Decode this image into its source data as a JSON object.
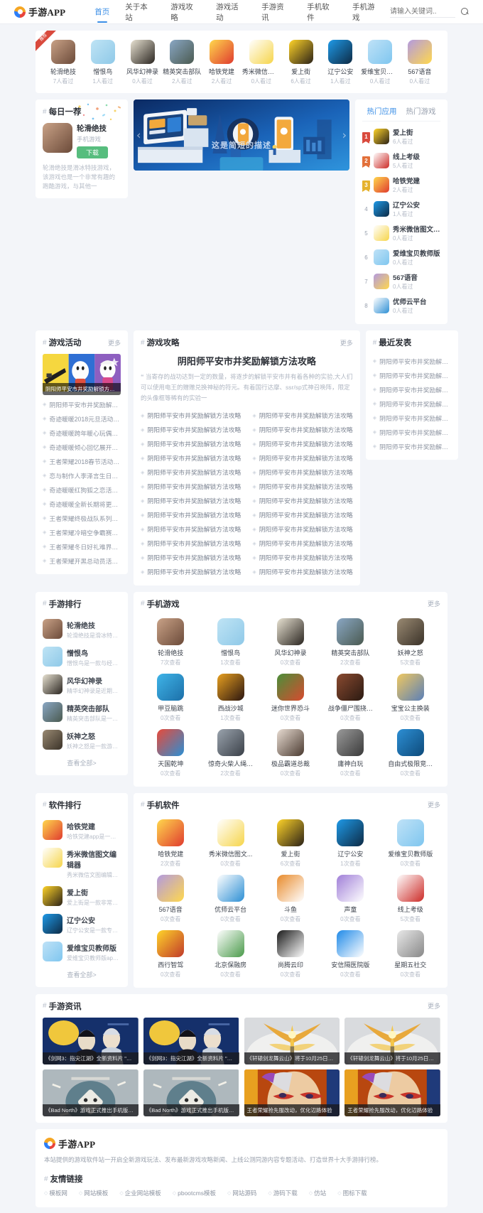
{
  "header": {
    "logo_text": "手游APP",
    "nav": [
      {
        "label": "首页",
        "active": true
      },
      {
        "label": "关于本站",
        "active": false
      },
      {
        "label": "游戏攻略",
        "active": false
      },
      {
        "label": "游戏活动",
        "active": false
      },
      {
        "label": "手游资讯",
        "active": false
      },
      {
        "label": "手机软件",
        "active": false
      },
      {
        "label": "手机游戏",
        "active": false
      }
    ],
    "search_placeholder": "请输入关键词..",
    "search_value": ""
  },
  "apps_row": {
    "ribbon_label": "推荐",
    "items": [
      {
        "name": "轮滑绝技",
        "count": "7人看过",
        "c1": "#c9a287",
        "c2": "#6b4a39"
      },
      {
        "name": "憎恨鸟",
        "count": "1人看过",
        "c1": "#bfe4f5",
        "c2": "#8fc9e8"
      },
      {
        "name": "风华幻神录",
        "count": "0人看过",
        "c1": "#e8e2d2",
        "c2": "#2a2520"
      },
      {
        "name": "精英突击部队",
        "count": "2人看过",
        "c1": "#8aa7c4",
        "c2": "#4a5a50"
      },
      {
        "name": "哈铁党建",
        "count": "2人看过",
        "c1": "#ffd84d",
        "c2": "#e03b2f"
      },
      {
        "name": "秀米微信图文编...",
        "count": "0人看过",
        "c1": "#ffffff",
        "c2": "#f6d54a"
      },
      {
        "name": "爱上街",
        "count": "6人看过",
        "c1": "#ffd429",
        "c2": "#2a2117"
      },
      {
        "name": "辽宁公安",
        "count": "1人看过",
        "c1": "#1f9ae8",
        "c2": "#0d2a44"
      },
      {
        "name": "爱维宝贝教师版",
        "count": "0人看过",
        "c1": "#bfe2f7",
        "c2": "#7fc6ef"
      },
      {
        "name": "567语音",
        "count": "0人看过",
        "c1": "#b39ae0",
        "c2": "#ffd84d"
      }
    ]
  },
  "daily": {
    "title": "每日一荐",
    "app_name": "轮滑绝技",
    "app_sub": "手机游戏",
    "download_label": "下载",
    "desc": "轮滑绝技是滑冰特技游戏，该游戏也是一个非常有趣的跑酷游戏，与其他一"
  },
  "banner": {
    "caption": "这是简短的描述",
    "prev_label": "‹",
    "next_label": "›"
  },
  "hot": {
    "tabs": [
      {
        "label": "热门应用",
        "active": true
      },
      {
        "label": "热门游戏",
        "active": false
      }
    ],
    "items": [
      {
        "rank": "1",
        "name": "爱上街",
        "count": "6人看过",
        "c1": "#ffd429",
        "c2": "#2a2117"
      },
      {
        "rank": "2",
        "name": "线上考级",
        "count": "5人看过",
        "c1": "#ffffff",
        "c2": "#cc2b27"
      },
      {
        "rank": "3",
        "name": "哈铁党建",
        "count": "2人看过",
        "c1": "#ffd84d",
        "c2": "#e03b2f"
      },
      {
        "rank": "4",
        "name": "辽宁公安",
        "count": "1人看过",
        "c1": "#1f9ae8",
        "c2": "#0d2a44"
      },
      {
        "rank": "5",
        "name": "秀米微信图文编...",
        "count": "0人看过",
        "c1": "#ffffff",
        "c2": "#f6d54a"
      },
      {
        "rank": "6",
        "name": "爱维宝贝教师版",
        "count": "0人看过",
        "c1": "#bfe2f7",
        "c2": "#7fc6ef"
      },
      {
        "rank": "7",
        "name": "567语音",
        "count": "0人看过",
        "c1": "#b39ae0",
        "c2": "#ffd84d"
      },
      {
        "rank": "8",
        "name": "优师云平台",
        "count": "0人看过",
        "c1": "#ffffff",
        "c2": "#2d8fd4"
      }
    ]
  },
  "recent": {
    "title": "最近发表",
    "items": [
      "阴阳师平安市井奖励解锁方法攻…",
      "阴阳师平安市井奖励解锁方法攻…",
      "阴阳师平安市井奖励解锁方法攻…",
      "阴阳师平安市井奖励解锁方法攻…",
      "阴阳师平安市井奖励解锁方法攻…",
      "阴阳师平安市井奖励解锁方法攻…",
      "阴阳师平安市井奖励解锁方法攻…"
    ]
  },
  "activity": {
    "title": "游戏活动",
    "more_label": "更多",
    "hero_caption": "阴阳师平安市井奖励解锁方法…",
    "items": [
      "阴阳师平安市井奖励解锁方法攻略",
      "奇迹暖暖2018元旦活动 云杳之愿…",
      "奇迹暖暖跨年暖心玩偶活动 新年…",
      "奇迹暖暖倾心回忆展开活动 誓言…",
      "王者荣耀2018春节活动勾省 2018…",
      "恋与制作人李泽言生日活动第一弹…",
      "奇迹暖暖红狗狐之恋活动 坚到这…",
      "奇迹暖暖全新长期将更新多重活动…",
      "王者荣耀终极战队系列挑战第二弹…",
      "王者荣耀冷暗空争霸赛活动地址 …",
      "王者荣耀冬日好礼难界返活动 SN…",
      "王者荣耀开黑总动员活动 直取SN…"
    ]
  },
  "strategy": {
    "title": "游戏攻略",
    "more_label": "更多",
    "headline": "阴阳师平安市井奖励解锁方法攻略",
    "desc": "当寄存的战功达到一定的数量，将逐步的解锁平安市井有着各种的实验,大人们可以使用电王的赠赠兑换神秘的符元。有着国行达摩、ssr/sp式神召唤阵，限定的头像框等稀有的实验一",
    "col_left": [
      "阴阳师平安市井奖励解锁方法攻略",
      "阴阳师平安市井奖励解锁方法攻略",
      "阴阳师平安市井奖励解锁方法攻略",
      "阴阳师平安市井奖励解锁方法攻略",
      "阴阳师平安市井奖励解锁方法攻略",
      "阴阳师平安市井奖励解锁方法攻略",
      "阴阳师平安市井奖励解锁方法攻略",
      "阴阳师平安市井奖励解锁方法攻略",
      "阴阳师平安市井奖励解锁方法攻略",
      "阴阳师平安市井奖励解锁方法攻略",
      "阴阳师平安市井奖励解锁方法攻略",
      "阴阳师平安市井奖励解锁方法攻略"
    ],
    "col_right": [
      "阴阳师平安市井奖励解锁方法攻略",
      "阴阳师平安市井奖励解锁方法攻略",
      "阴阳师平安市井奖励解锁方法攻略",
      "阴阳师平安市井奖励解锁方法攻略",
      "阴阳师平安市井奖励解锁方法攻略",
      "阴阳师平安市井奖励解锁方法攻略",
      "阴阳师平安市井奖励解锁方法攻略",
      "阴阳师平安市井奖励解锁方法攻略",
      "阴阳师平安市井奖励解锁方法攻略",
      "阴阳师平安市井奖励解锁方法攻略",
      "阴阳师平安市井奖励解锁方法攻略",
      "阴阳师平安市井奖励解锁方法攻略"
    ]
  },
  "game_rank": {
    "title": "手游排行",
    "view_all": "查看全部>",
    "items": [
      {
        "name": "轮滑绝技",
        "desc": "轮滑绝技是滑冰特技游戏…",
        "c1": "#c9a287",
        "c2": "#6b4a39"
      },
      {
        "name": "憎恨鸟",
        "desc": "憎恨鸟是一款与经典游戏…",
        "c1": "#bfe4f5",
        "c2": "#8fc9e8"
      },
      {
        "name": "风华幻神录",
        "desc": "精华幻神录是近期最受欢…",
        "c1": "#e8e2d2",
        "c2": "#2a2520"
      },
      {
        "name": "精英突击部队",
        "desc": "精英突击部队是一款可以…",
        "c1": "#8aa7c4",
        "c2": "#4a5a50"
      },
      {
        "name": "妖神之怒",
        "desc": "妖神之怒是一款游戏风格…",
        "c1": "#9a8a73",
        "c2": "#3a3228"
      }
    ]
  },
  "mobile_games": {
    "title": "手机游戏",
    "more_label": "更多",
    "items": [
      {
        "name": "轮滑绝技",
        "count": "7次查看",
        "c1": "#c9a287",
        "c2": "#6b4a39"
      },
      {
        "name": "憎恨鸟",
        "count": "1次查看",
        "c1": "#bfe4f5",
        "c2": "#8fc9e8"
      },
      {
        "name": "风华幻神录",
        "count": "0次查看",
        "c1": "#e8e2d2",
        "c2": "#2a2520"
      },
      {
        "name": "精英突击部队",
        "count": "2次查看",
        "c1": "#8aa7c4",
        "c2": "#4a5a50"
      },
      {
        "name": "妖神之怒",
        "count": "5次查看",
        "c1": "#9a8a73",
        "c2": "#3a3228"
      },
      {
        "name": "甲豆脑跳",
        "count": "0次查看",
        "c1": "#3fb4e8",
        "c2": "#1c6fa8"
      },
      {
        "name": "西战沙城",
        "count": "1次查看",
        "c1": "#e8a020",
        "c2": "#2a1510"
      },
      {
        "name": "迷你世界恐斗",
        "count": "0次查看",
        "c1": "#4a8f3a",
        "c2": "#d84a2f"
      },
      {
        "name": "战争僵尸围挠…",
        "count": "0次查看",
        "c1": "#8a4a30",
        "c2": "#2a1a12"
      },
      {
        "name": "宝宝公主换装",
        "count": "0次查看",
        "c1": "#f0c860",
        "c2": "#5a7fb8"
      },
      {
        "name": "天国乾坤",
        "count": "0次查看",
        "c1": "#e84a3a",
        "c2": "#2a8fd4"
      },
      {
        "name": "惊奇火柴人绳…",
        "count": "2次查看",
        "c1": "#9aa3ad",
        "c2": "#3a4048"
      },
      {
        "name": "极品霸道总裁",
        "count": "0次查看",
        "c1": "#e8dcd2",
        "c2": "#4a3a30"
      },
      {
        "name": "庸神白玩",
        "count": "0次查看",
        "c1": "#9a9a9a",
        "c2": "#3a3a3a"
      },
      {
        "name": "自由式极限竞…",
        "count": "0次查看",
        "c1": "#2d8fd4",
        "c2": "#0d4a7a"
      }
    ]
  },
  "software_rank": {
    "title": "软件排行",
    "view_all": "查看全部>",
    "items": [
      {
        "name": "哈铁党建",
        "desc": "哈铁党建app是一款党建…",
        "c1": "#ffd84d",
        "c2": "#e03b2f"
      },
      {
        "name": "秀米微信图文编辑器",
        "desc": "秀米微信文图编辑器是一…",
        "c1": "#ffffff",
        "c2": "#f6d54a"
      },
      {
        "name": "爱上街",
        "desc": "爱上街是一款非常轻松,便…",
        "c1": "#ffd429",
        "c2": "#2a2117"
      },
      {
        "name": "辽宁公安",
        "desc": "辽宁公安是一款专门面向…",
        "c1": "#1f9ae8",
        "c2": "#0d2a44"
      },
      {
        "name": "爱维宝贝教师版",
        "desc": "爱维宝贝教师版app是一…",
        "c1": "#bfe2f7",
        "c2": "#7fc6ef"
      }
    ]
  },
  "mobile_software": {
    "title": "手机软件",
    "more_label": "更多",
    "items": [
      {
        "name": "哈铁党建",
        "count": "2次查看",
        "c1": "#ffd84d",
        "c2": "#e03b2f"
      },
      {
        "name": "秀米微信图文...",
        "count": "0次查看",
        "c1": "#ffffff",
        "c2": "#f6d54a"
      },
      {
        "name": "爱上街",
        "count": "6次查看",
        "c1": "#ffd429",
        "c2": "#2a2117"
      },
      {
        "name": "辽宁公安",
        "count": "1次查看",
        "c1": "#1f9ae8",
        "c2": "#0d2a44"
      },
      {
        "name": "爱维宝贝教师版",
        "count": "0次查看",
        "c1": "#bfe2f7",
        "c2": "#7fc6ef"
      },
      {
        "name": "567语音",
        "count": "0次查看",
        "c1": "#b39ae0",
        "c2": "#ffd84d"
      },
      {
        "name": "优师云平台",
        "count": "0次查看",
        "c1": "#ffffff",
        "c2": "#2d8fd4"
      },
      {
        "name": "斗鱼",
        "count": "0次查看",
        "c1": "#e88a2a",
        "c2": "#ffffff"
      },
      {
        "name": "声童",
        "count": "0次查看",
        "c1": "#a07fd8",
        "c2": "#ffffff"
      },
      {
        "name": "线上考级",
        "count": "5次查看",
        "c1": "#ffffff",
        "c2": "#cc2b27"
      },
      {
        "name": "西行智驾",
        "count": "0次查看",
        "c1": "#ffd429",
        "c2": "#c0392b"
      },
      {
        "name": "北京保融房",
        "count": "0次查看",
        "c1": "#ffffff",
        "c2": "#4a9a4a"
      },
      {
        "name": "尚腾云印",
        "count": "0次查看",
        "c1": "#1a1a1a",
        "c2": "#ffffff"
      },
      {
        "name": "安信隔医院版",
        "count": "0次查看",
        "c1": "#1f8ae8",
        "c2": "#ffffff"
      },
      {
        "name": "星期五社交",
        "count": "0次查看",
        "c1": "#e8e8e8",
        "c2": "#888888"
      }
    ]
  },
  "news": {
    "title": "手游资讯",
    "more_label": "更多",
    "items": [
      {
        "caption": "《剑网3：指尖江湖》全新资料片 \"风起…",
        "kind": "jx3"
      },
      {
        "caption": "《剑网3：指尖江湖》全新资料片 \"风起…",
        "kind": "jx3"
      },
      {
        "caption": "《轩辕剑龙舞云山》将于10月25日全平…",
        "kind": "xy"
      },
      {
        "caption": "《轩辕剑龙舞云山》将于10月25日全平…",
        "kind": "xy"
      },
      {
        "caption": "《Bad North》游戏正式推出手机版，…",
        "kind": "bn"
      },
      {
        "caption": "《Bad North》游戏正式推出手机版，…",
        "kind": "bn"
      },
      {
        "caption": "王者荣耀抢先服改动，优化辺路体验",
        "kind": "wz"
      },
      {
        "caption": "王者荣耀抢先服改动，优化辺路体验",
        "kind": "wz"
      }
    ]
  },
  "footer": {
    "logo_text": "手游APP",
    "desc": "本站提供的游戏软件站一开启全新游戏玩法、发布最新游戏攻略新闻、上线公测同游内容专题活动、打造世界十大手游排行榜。",
    "links_title": "友情链接",
    "links": [
      "模板网",
      "网站模板",
      "企业网站模板",
      "pbootcms模板",
      "网站源码",
      "游码下载",
      "仿站",
      "图标下载"
    ]
  }
}
